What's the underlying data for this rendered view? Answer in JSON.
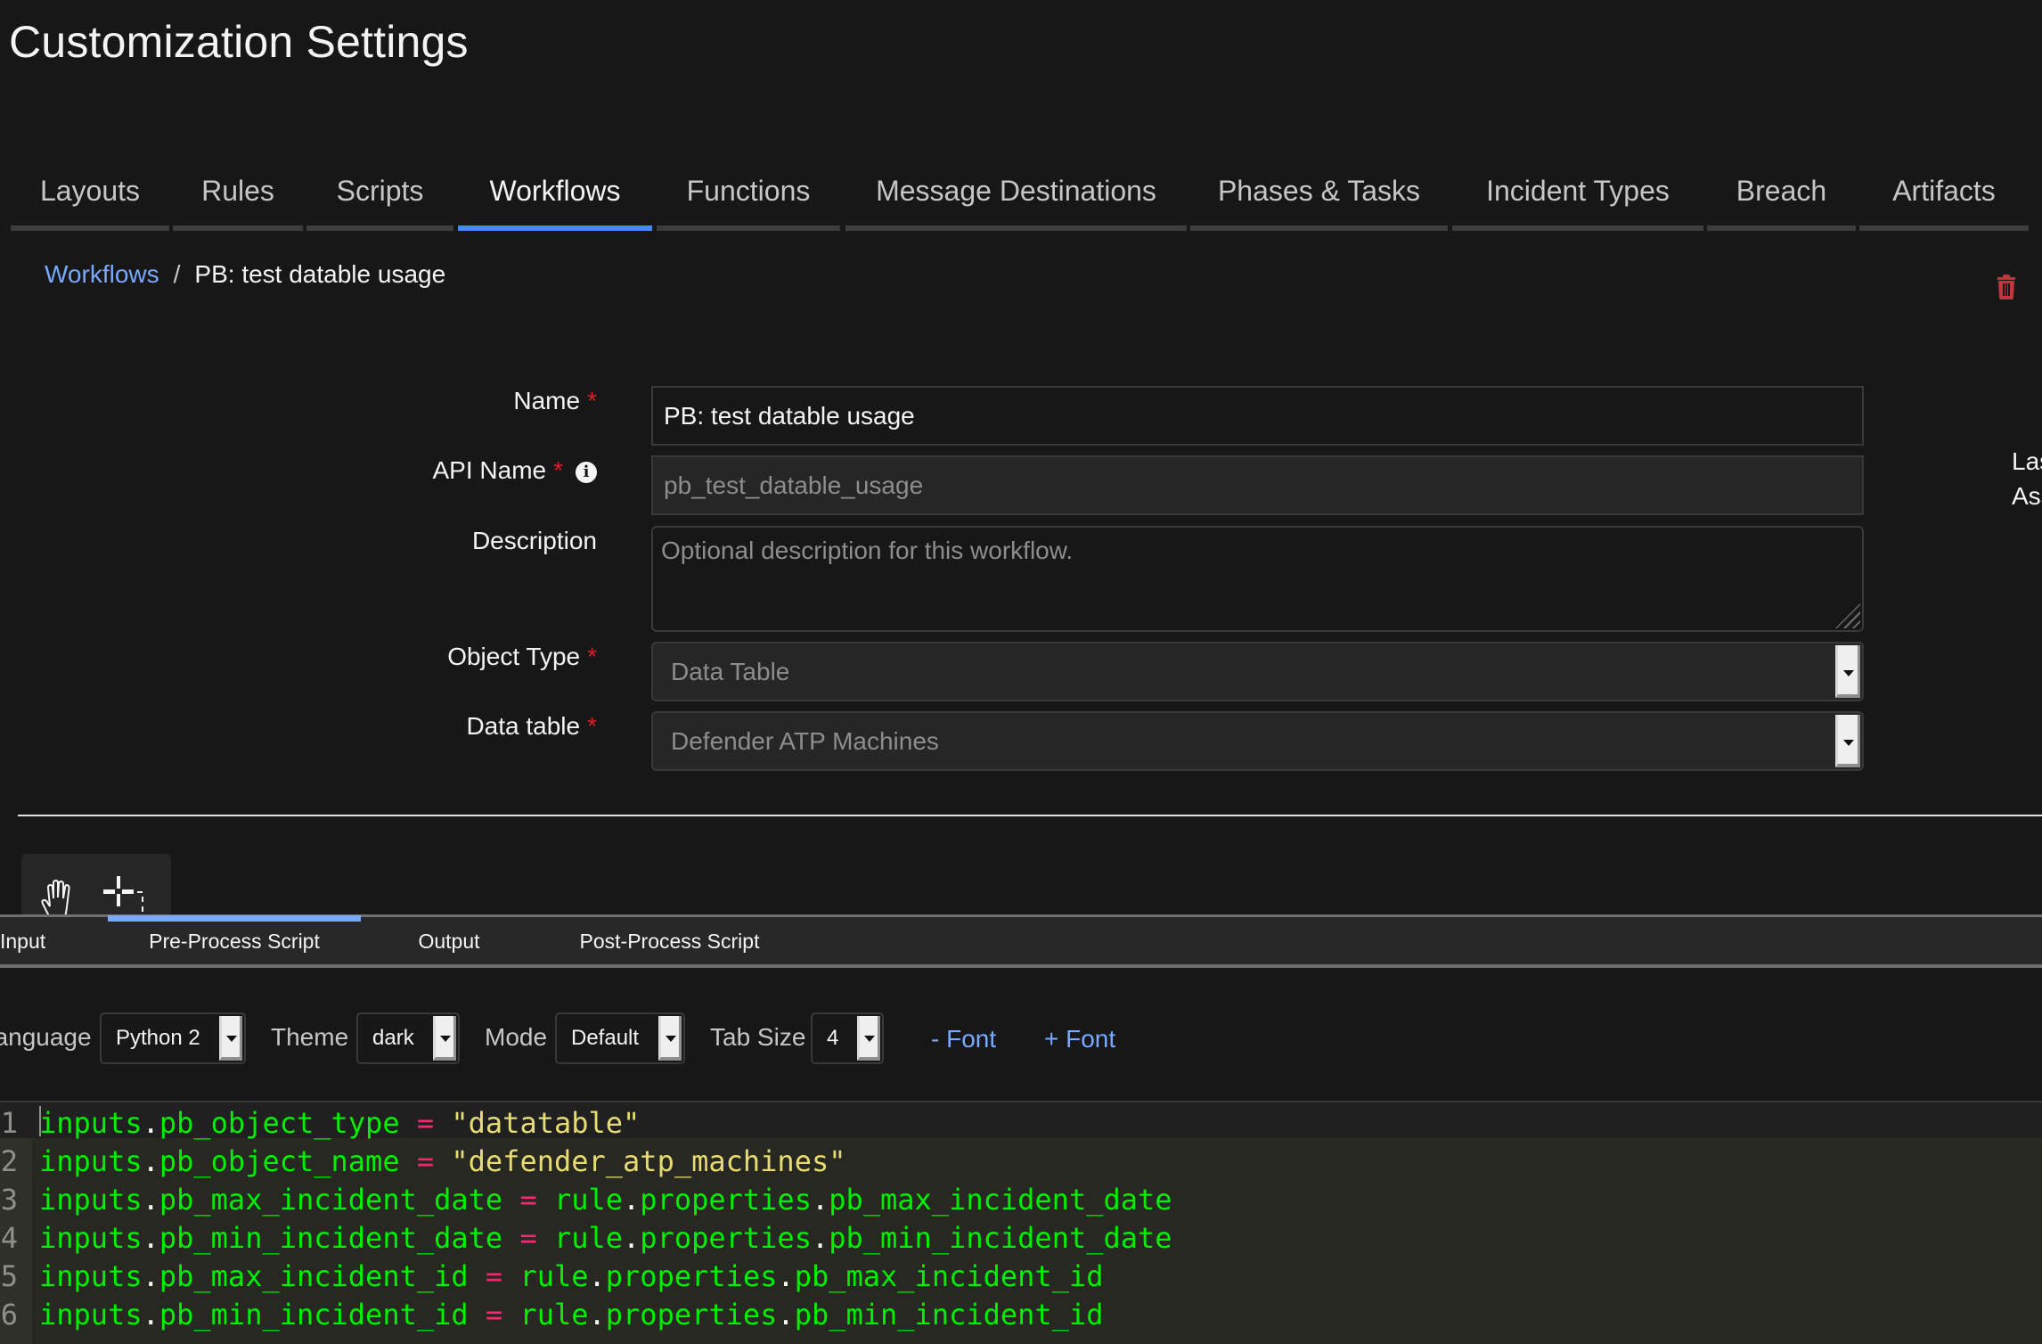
{
  "page": {
    "title": "Customization Settings"
  },
  "tabs": [
    {
      "label": "Layouts",
      "active": false
    },
    {
      "label": "Rules",
      "active": false
    },
    {
      "label": "Scripts",
      "active": false
    },
    {
      "label": "Workflows",
      "active": true
    },
    {
      "label": "Functions",
      "active": false
    },
    {
      "label": "Message Destinations",
      "active": false
    },
    {
      "label": "Phases & Tasks",
      "active": false
    },
    {
      "label": "Incident Types",
      "active": false
    },
    {
      "label": "Breach",
      "active": false
    },
    {
      "label": "Artifacts",
      "active": false
    }
  ],
  "breadcrumb": {
    "parent": "Workflows",
    "separator": "/",
    "current": "PB: test datable usage"
  },
  "icons": {
    "delete": "trash-icon",
    "info": "info-icon",
    "hand": "hand-tool-icon",
    "select": "select-tool-icon"
  },
  "form": {
    "required_marker": "*",
    "name": {
      "label": "Name",
      "value": "PB: test datable usage"
    },
    "api_name": {
      "label": "API Name",
      "value": "pb_test_datable_usage",
      "info_glyph": "i"
    },
    "description": {
      "label": "Description",
      "placeholder": "Optional description for this workflow."
    },
    "object_type": {
      "label": "Object Type",
      "value": "Data Table"
    },
    "data_table": {
      "label": "Data table",
      "value": "Defender ATP Machines"
    }
  },
  "side_panel_cut": {
    "line1": "Las",
    "line2": "Ass"
  },
  "editor_tabs": [
    {
      "label": "Input",
      "active": false
    },
    {
      "label": "Pre-Process Script",
      "active": true
    },
    {
      "label": "Output",
      "active": false
    },
    {
      "label": "Post-Process Script",
      "active": false
    }
  ],
  "editor_toolbar": {
    "language": {
      "label": "Language",
      "value": "Python 2"
    },
    "theme": {
      "label": "Theme",
      "value": "dark"
    },
    "mode": {
      "label": "Mode",
      "value": "Default"
    },
    "tab_size": {
      "label": "Tab Size",
      "value": "4"
    },
    "font_minus": "- Font",
    "font_plus": "+ Font"
  },
  "code": {
    "lines": [
      {
        "n": "1",
        "lhs": [
          "inputs",
          "pb_object_type"
        ],
        "op": "=",
        "rhs_str": "\"datatable\""
      },
      {
        "n": "2",
        "lhs": [
          "inputs",
          "pb_object_name"
        ],
        "op": "=",
        "rhs_str": "\"defender_atp_machines\""
      },
      {
        "n": "3",
        "lhs": [
          "inputs",
          "pb_max_incident_date"
        ],
        "op": "=",
        "rhs": [
          "rule",
          "properties",
          "pb_max_incident_date"
        ]
      },
      {
        "n": "4",
        "lhs": [
          "inputs",
          "pb_min_incident_date"
        ],
        "op": "=",
        "rhs": [
          "rule",
          "properties",
          "pb_min_incident_date"
        ]
      },
      {
        "n": "5",
        "lhs": [
          "inputs",
          "pb_max_incident_id"
        ],
        "op": "=",
        "rhs": [
          "rule",
          "properties",
          "pb_max_incident_id"
        ]
      },
      {
        "n": "6",
        "lhs": [
          "inputs",
          "pb_min_incident_id"
        ],
        "op": "=",
        "rhs": [
          "rule",
          "properties",
          "pb_min_incident_id"
        ]
      }
    ]
  },
  "colors": {
    "accent": "#4589ff",
    "link": "#78a9ff",
    "danger": "#da1e28",
    "code_identifier": "#00f000",
    "code_operator": "#f92672",
    "code_string": "#e6db74"
  }
}
